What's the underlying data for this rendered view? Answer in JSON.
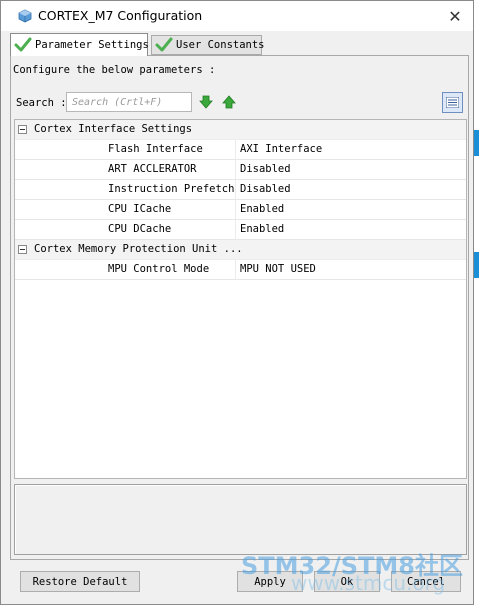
{
  "window": {
    "title": "CORTEX_M7 Configuration",
    "close_glyph": "✕",
    "icon": "cube-icon"
  },
  "tabs": [
    {
      "label": "Parameter Settings",
      "active": true,
      "icon": "check-icon"
    },
    {
      "label": "User Constants",
      "active": false,
      "icon": "check-icon"
    }
  ],
  "panel": {
    "configure_label": "Configure the below parameters :"
  },
  "search": {
    "label": "Search :",
    "placeholder": "Search (Crtl+F)"
  },
  "tree": {
    "groups": [
      {
        "label": "Cortex Interface Settings",
        "params": [
          {
            "name": "Flash Interface",
            "value": "AXI Interface"
          },
          {
            "name": "ART ACCLERATOR",
            "value": "Disabled"
          },
          {
            "name": "Instruction Prefetch",
            "value": "Disabled"
          },
          {
            "name": "CPU ICache",
            "value": "Enabled"
          },
          {
            "name": "CPU DCache",
            "value": "Enabled"
          }
        ]
      },
      {
        "label": "Cortex Memory Protection Unit ...",
        "params": [
          {
            "name": "MPU Control Mode",
            "value": "MPU NOT USED"
          }
        ]
      }
    ]
  },
  "buttons": {
    "restore_default": "Restore Default",
    "apply": "Apply",
    "ok": "Ok",
    "cancel": "Cancel"
  },
  "watermark": {
    "main": "STM32/STM8社区",
    "sub": "www.stmcu.org"
  },
  "colors": {
    "accent_blue": "#1a8fd8",
    "arrow_green": "#3aa83a",
    "check_green": "#4caf50"
  }
}
